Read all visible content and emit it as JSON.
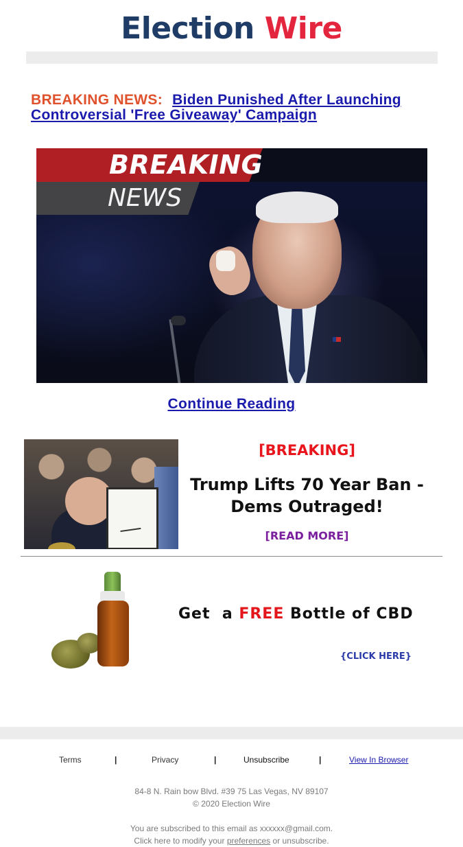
{
  "brand": {
    "name_part1": "Election ",
    "name_part2": "Wire"
  },
  "headline": {
    "tag": "BREAKING NEWS:",
    "link_text": "Biden Punished After Launching Controversial 'Free Giveaway' Campaign"
  },
  "hero": {
    "band_top": "BREAKING",
    "band_bottom": "NEWS"
  },
  "continue_label": "Continue Reading",
  "promo": {
    "tag": "[BREAKING]",
    "title": "Trump Lifts 70 Year Ban - Dems Outraged!",
    "cta": "[READ MORE]"
  },
  "cbd": {
    "headline_pre": "Get  a ",
    "headline_free": "FREE",
    "headline_post": " Bottle of CBD",
    "cta": "{CLICK HERE}"
  },
  "footer": {
    "links": {
      "terms": "Terms",
      "privacy": "Privacy",
      "unsubscribe": "Unsubscribe",
      "view_in_browser": "View In Browser"
    },
    "separator": "|",
    "address": "84-8 N. Rain bow Blvd. #39 75 Las Vegas, NV 89107",
    "copyright": "© 2020 Election Wire",
    "subscribed": "You are subscribed to this email as xxxxxx@gmail.com.",
    "modify_pre": "Click here to modify your ",
    "modify_link": "preferences",
    "modify_post": " or unsubscribe."
  },
  "colors": {
    "brand_navy": "#1f3c66",
    "brand_red": "#e3253d",
    "link_blue": "#1a1aad",
    "breaking_orange": "#e0522d"
  },
  "icons": {
    "logo": "election-wire-logo"
  }
}
